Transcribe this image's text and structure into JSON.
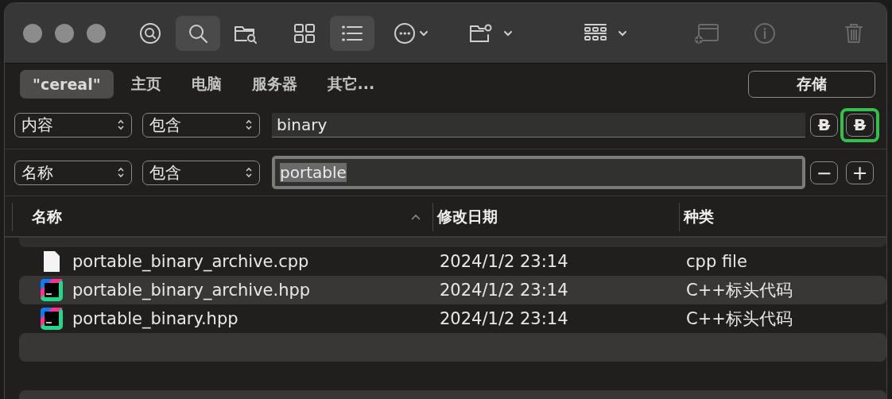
{
  "toolbar": [
    {
      "kind": "scope-search",
      "selected": false,
      "disabled": false
    },
    {
      "kind": "search",
      "selected": true,
      "disabled": false
    },
    {
      "kind": "folder-search",
      "selected": false,
      "disabled": false
    },
    {
      "kind": "grid",
      "selected": false,
      "disabled": false
    },
    {
      "kind": "list",
      "selected": true,
      "disabled": false
    },
    {
      "kind": "more",
      "selected": false,
      "disabled": false
    },
    {
      "kind": "folder-gear",
      "selected": false,
      "disabled": false
    },
    {
      "kind": "gallery",
      "selected": false,
      "disabled": false
    },
    {
      "kind": "new-window",
      "selected": false,
      "disabled": true
    },
    {
      "kind": "info",
      "selected": false,
      "disabled": true
    },
    {
      "kind": "trash",
      "selected": false,
      "disabled": true
    }
  ],
  "scopes": [
    {
      "label": "\"cereal\"",
      "selected": true
    },
    {
      "label": "主页",
      "selected": false
    },
    {
      "label": "电脑",
      "selected": false
    },
    {
      "label": "服务器",
      "selected": false
    },
    {
      "label": "其它...",
      "selected": false
    }
  ],
  "save_button": "存储",
  "criteria": [
    {
      "attribute": "内容",
      "operator": "包含",
      "value": "binary",
      "focused": false,
      "buttons": [
        {
          "kind": "text",
          "label": "B",
          "highlighted": false
        },
        {
          "kind": "text-strike",
          "label": "B",
          "highlighted": true
        }
      ]
    },
    {
      "attribute": "名称",
      "operator": "包含",
      "value": "portable",
      "focused": true,
      "buttons": [
        {
          "kind": "minus",
          "label": "−",
          "highlighted": false
        },
        {
          "kind": "plus",
          "label": "+",
          "highlighted": false
        }
      ]
    }
  ],
  "table": {
    "columns": [
      {
        "label": "名称",
        "sorted": true
      },
      {
        "label": "修改日期",
        "sorted": false
      },
      {
        "label": "种类",
        "sorted": false
      }
    ],
    "rows": [
      {
        "kind": "document",
        "name": "portable_binary_archive.cpp",
        "date": "2024/1/2 23:14",
        "type": "cpp file"
      },
      {
        "kind": "clion",
        "name": "portable_binary_archive.hpp",
        "date": "2024/1/2 23:14",
        "type": "C++标头代码"
      },
      {
        "kind": "clion",
        "name": "portable_binary.hpp",
        "date": "2024/1/2 23:14",
        "type": "C++标头代码"
      }
    ]
  }
}
